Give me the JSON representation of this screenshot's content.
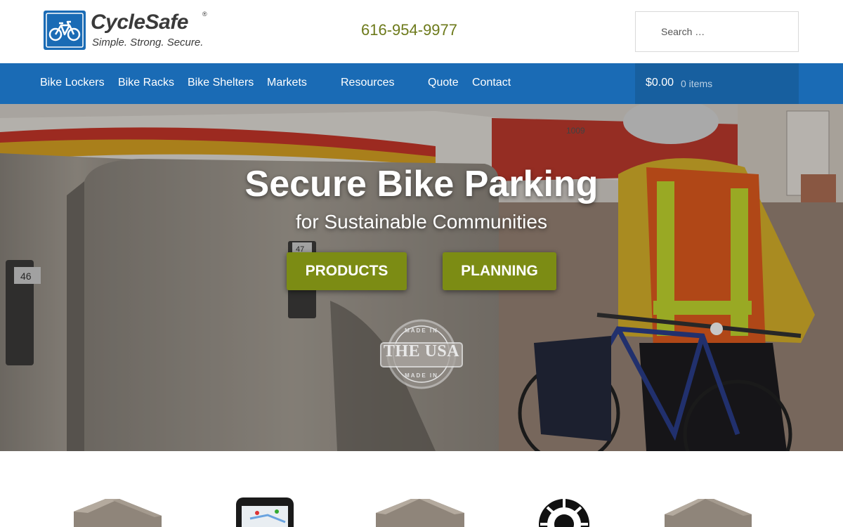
{
  "brand": {
    "name": "CycleSafe",
    "registered_mark": "®",
    "tagline": "Simple. Strong. Secure.",
    "color": "#1a6bb5"
  },
  "header": {
    "phone": "616-954-9977",
    "search_placeholder": "Search …"
  },
  "nav": {
    "items": [
      "Bike Lockers",
      "Bike Racks",
      "Bike Shelters",
      "Markets",
      "Resources",
      "Quote",
      "Contact"
    ],
    "cart_total": "$0.00",
    "cart_count": "0 items"
  },
  "hero": {
    "title": "Secure Bike Parking",
    "subtitle": "for Sustainable Communities",
    "buttons": {
      "products": "PRODUCTS",
      "planning": "PLANNING"
    },
    "badge": {
      "top": "MADE IN",
      "main": "THE USA",
      "bottom": "MADE IN"
    },
    "locker_numbers": [
      "46",
      "47"
    ],
    "train_number": "1009",
    "button_color": "#7c8c14"
  },
  "product_thumbs": [
    "locker-icon",
    "phone-app-icon",
    "double-locker-icon",
    "wheel-rack-icon",
    "locker-row-icon"
  ]
}
